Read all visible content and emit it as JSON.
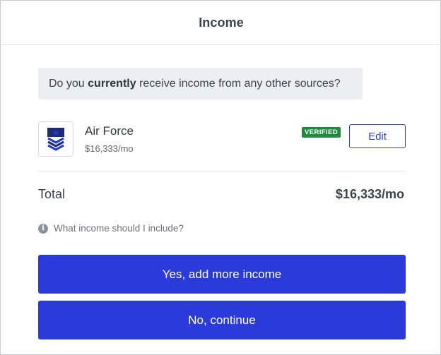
{
  "header": {
    "title": "Income"
  },
  "question": {
    "prefix": "Do you ",
    "emphasis": "currently",
    "suffix": " receive income from any other sources?"
  },
  "income_sources": [
    {
      "name": "Air Force",
      "amount": "$16,333/mo",
      "status_badge": "VERIFIED",
      "edit_label": "Edit",
      "icon": "air-force-chevron-icon"
    }
  ],
  "total": {
    "label": "Total",
    "value": "$16,333/mo"
  },
  "help": {
    "label": "What income should I include?",
    "icon": "info-icon"
  },
  "actions": {
    "add_more_label": "Yes, add more income",
    "continue_label": "No, continue"
  },
  "colors": {
    "primary": "#2b3bd9",
    "verified": "#1f8a3b",
    "question_bg": "#eceff1",
    "text": "#3a444d"
  }
}
